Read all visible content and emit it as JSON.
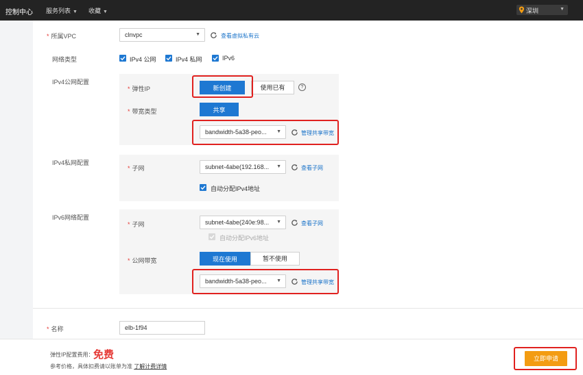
{
  "topbar": {
    "brand": "控制中心",
    "menus": [
      "服务列表",
      "收藏"
    ],
    "region": "深圳"
  },
  "form": {
    "vpc": {
      "label": "所属VPC",
      "value": "clnvpc",
      "link": "查看虚拟私有云"
    },
    "network_type": {
      "label": "网络类型",
      "options": [
        "IPv4 公网",
        "IPv4 私网",
        "IPv6"
      ]
    },
    "ipv4_public": {
      "label": "IPv4公网配置",
      "eip": {
        "label": "弹性IP",
        "new": "新创建",
        "existing": "使用已有"
      },
      "bandwidth_type": {
        "label": "带宽类型",
        "shared": "共享"
      },
      "bandwidth": {
        "value": "bandwidth-5a38-peo...",
        "link": "管理共享带宽"
      }
    },
    "ipv4_private": {
      "label": "IPv4私网配置",
      "subnet": {
        "label": "子网",
        "value": "subnet-4abe(192.168...",
        "link": "查看子网"
      },
      "auto_assign": "自动分配IPv4地址"
    },
    "ipv6": {
      "label": "IPv6网络配置",
      "subnet": {
        "label": "子网",
        "value": "subnet-4abe(240e:98...",
        "link": "查看子网"
      },
      "auto_assign": "自动分配IPv6地址",
      "public_bandwidth": {
        "label": "公网带宽",
        "use_now": "现在使用",
        "not_use": "暂不使用"
      },
      "bandwidth": {
        "value": "bandwidth-5a38-peo...",
        "link": "管理共享带宽"
      }
    },
    "name": {
      "label": "名称",
      "value": "elb-1f94"
    }
  },
  "footer": {
    "fee_label": "弹性IP配置费用：",
    "fee_value": "免费",
    "note_prefix": "参考价格，具体扣费请以账单为准",
    "note_link": "了解计费详情",
    "submit": "立即申请"
  },
  "colors": {
    "primary": "#1e78d2",
    "accent": "#f39c12",
    "required": "#e53935",
    "highlight": "#e0201e"
  }
}
